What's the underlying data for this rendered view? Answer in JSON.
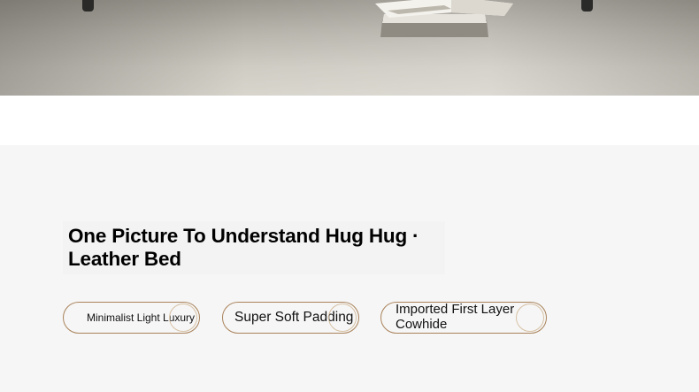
{
  "hero": {
    "alt_theme": "bed-with-books-photo"
  },
  "section": {
    "title": "One Picture To Understand Hug Hug · Leather Bed"
  },
  "tags": [
    {
      "label": "Minimalist Light Luxury"
    },
    {
      "label": "Super Soft Padding"
    },
    {
      "label": "Imported First Layer Cowhide"
    }
  ],
  "colors": {
    "tag_border": "#a9825a",
    "panel_bg": "#f6f6f6"
  }
}
